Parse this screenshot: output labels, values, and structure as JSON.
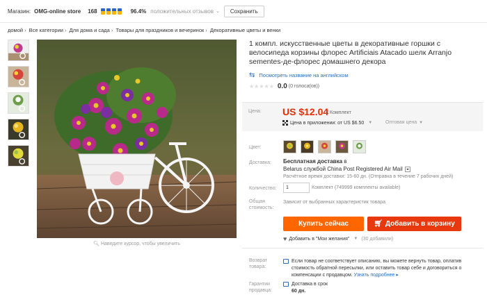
{
  "store": {
    "label": "Магазин:",
    "name": "OMG-online store",
    "score": "168",
    "positive_pct": "96.4%",
    "feedback_text": "положительных отзывов",
    "save_label": "Сохранить"
  },
  "breadcrumb": [
    "домой",
    "Все категории",
    "Для дома и сада",
    "Товары для праздников и вечеринок",
    "Декоративные цветы и венки"
  ],
  "product": {
    "title": "1 компл. искусственные цветы в декоративные горшки с велосипеда корзины флорес Artificiais Atacado шелк Arranjo sementes-де-флорес домашнего декора",
    "translate_link": "Посмотреть название на английском",
    "rating_value": "0.0",
    "votes": "(0 голоса(ов))",
    "zoom_hint": "Наведите курсор, чтобы увеличить"
  },
  "price": {
    "label": "Цена:",
    "value": "US $12.04",
    "unit": "/ Комплект",
    "app_price": "Цена в приложении: от US $6.50",
    "wholesale": "Оптовая цена"
  },
  "options": {
    "color_label": "Цвет:",
    "shipping_label": "Доставка:",
    "free_shipping": "Бесплатная доставка",
    "free_shipping_in": "в",
    "ship_method": "Belarus службой China Post Registered Air Mail",
    "ship_time": "Расчётное время доставки: 15-60 дн. (Отправка в течение 7 рабочих дней)",
    "qty_label": "Количество:",
    "qty_value": "1",
    "qty_info": "Комплект (749999 комплекты available)",
    "total_label_1": "Общая",
    "total_label_2": "стоимость:",
    "total_value": "Зависит от выбранных характеристик товара"
  },
  "actions": {
    "buy_now": "Купить сейчас",
    "add_to_cart": "Добавить в корзину",
    "wishlist": "Добавить в \"Мои желания\"",
    "wishlist_count": "(30 добавили)"
  },
  "returns": {
    "label_1": "Возврат",
    "label_2": "товара:",
    "text": "Если товар не соответствует описанию, вы можете вернуть товар, оплатив стоимость обратной пересылки, или оставить товар себе и договориться о компенсации с продавцом.",
    "learn_more": "Узнать подробнее ▸"
  },
  "guarantee": {
    "label_1": "Гарантии",
    "label_2": "продавца:",
    "line1": "Доставка в срок",
    "line2": "60 дн."
  },
  "colors": {
    "accent": "#ff6600",
    "cart": "#e8380d",
    "price": "#e62e04",
    "link": "#2a6ebb"
  }
}
